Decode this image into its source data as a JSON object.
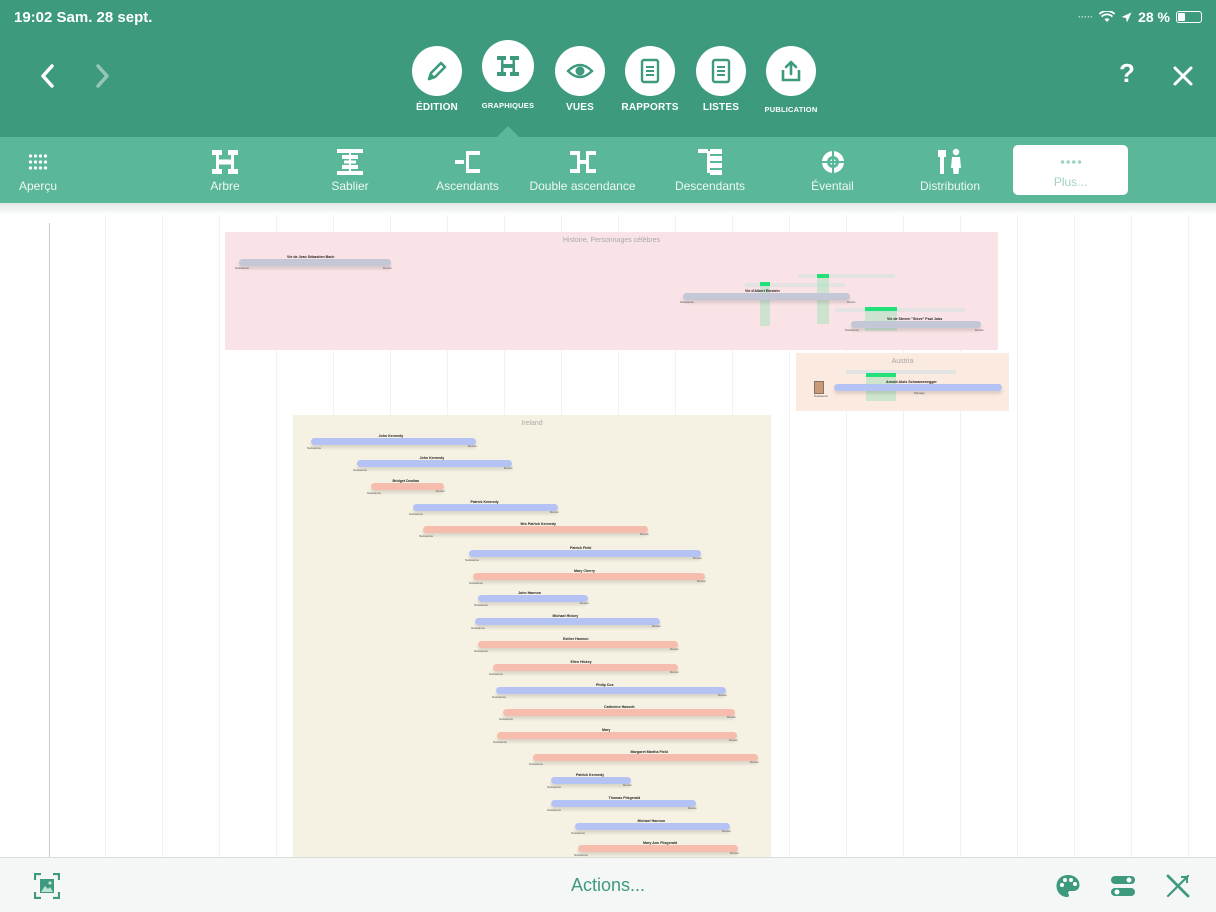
{
  "status": {
    "time_date": "19:02  Sam. 28 sept.",
    "battery": "28 %"
  },
  "topbar": {
    "modes": [
      {
        "label": "ÉDITION"
      },
      {
        "label": "GRAPHIQUES"
      },
      {
        "label": "VUES"
      },
      {
        "label": "RAPPORTS"
      },
      {
        "label": "LISTES"
      },
      {
        "label": "PUBLICATION"
      }
    ],
    "help_label": "?"
  },
  "charts": [
    {
      "label": "Aperçu"
    },
    {
      "label": "Arbre"
    },
    {
      "label": "Sablier"
    },
    {
      "label": "Ascendants"
    },
    {
      "label": "Double ascendance"
    },
    {
      "label": "Descendants"
    },
    {
      "label": "Éventail"
    },
    {
      "label": "Distribution"
    },
    {
      "label": "Plus..."
    }
  ],
  "canvas": {
    "panel_pink": {
      "title": "Histoire, Personnages célèbres",
      "people": [
        {
          "name": "Vie de Jean Sébastien Bach",
          "birth": "Naissance",
          "death": "Décès"
        },
        {
          "name": "Vie d'Albert Einstein",
          "birth": "Naissance",
          "death": "Décès"
        },
        {
          "name": "Vie de Steven \"Steve\" Paul Jobs",
          "birth": "Naissance",
          "death": "Décès"
        }
      ]
    },
    "panel_austria": {
      "title": "Austria",
      "people": [
        {
          "name": "Arnold Alois Schwarzenegger",
          "birth": "Naissance",
          "event": "Mariage"
        }
      ]
    },
    "panel_ireland": {
      "title": "Ireland",
      "people": [
        {
          "name": "John Kennedy",
          "sex": "m"
        },
        {
          "name": "John Kennedy",
          "sex": "m"
        },
        {
          "name": "Bridget Doolian",
          "sex": "f"
        },
        {
          "name": "Patrick Kennedy",
          "sex": "m"
        },
        {
          "name": "Mrs Patrick Kennedy",
          "sex": "f"
        },
        {
          "name": "Patrick Field",
          "sex": "m"
        },
        {
          "name": "Mary Cherry",
          "sex": "f"
        },
        {
          "name": "John Hannon",
          "sex": "m"
        },
        {
          "name": "Michael Hickey",
          "sex": "m"
        },
        {
          "name": "Esther Hannon",
          "sex": "f"
        },
        {
          "name": "Ellen Hickey",
          "sex": "f"
        },
        {
          "name": "Philip Cox",
          "sex": "m"
        },
        {
          "name": "Catherine Hassett",
          "sex": "f"
        },
        {
          "name": "Mary",
          "sex": "f"
        },
        {
          "name": "Margaret Martha Field",
          "sex": "f"
        },
        {
          "name": "Patrick Kennedy",
          "sex": "m"
        },
        {
          "name": "Thomas Fitzgerald",
          "sex": "m"
        },
        {
          "name": "Michael Hannon",
          "sex": "m"
        },
        {
          "name": "Mary Ann Fitzgerald",
          "sex": "f"
        }
      ],
      "birth_label": "Naissance",
      "death_label": "Décès",
      "marriage_label": "Mariage"
    }
  },
  "bottombar": {
    "actions_label": "Actions..."
  }
}
